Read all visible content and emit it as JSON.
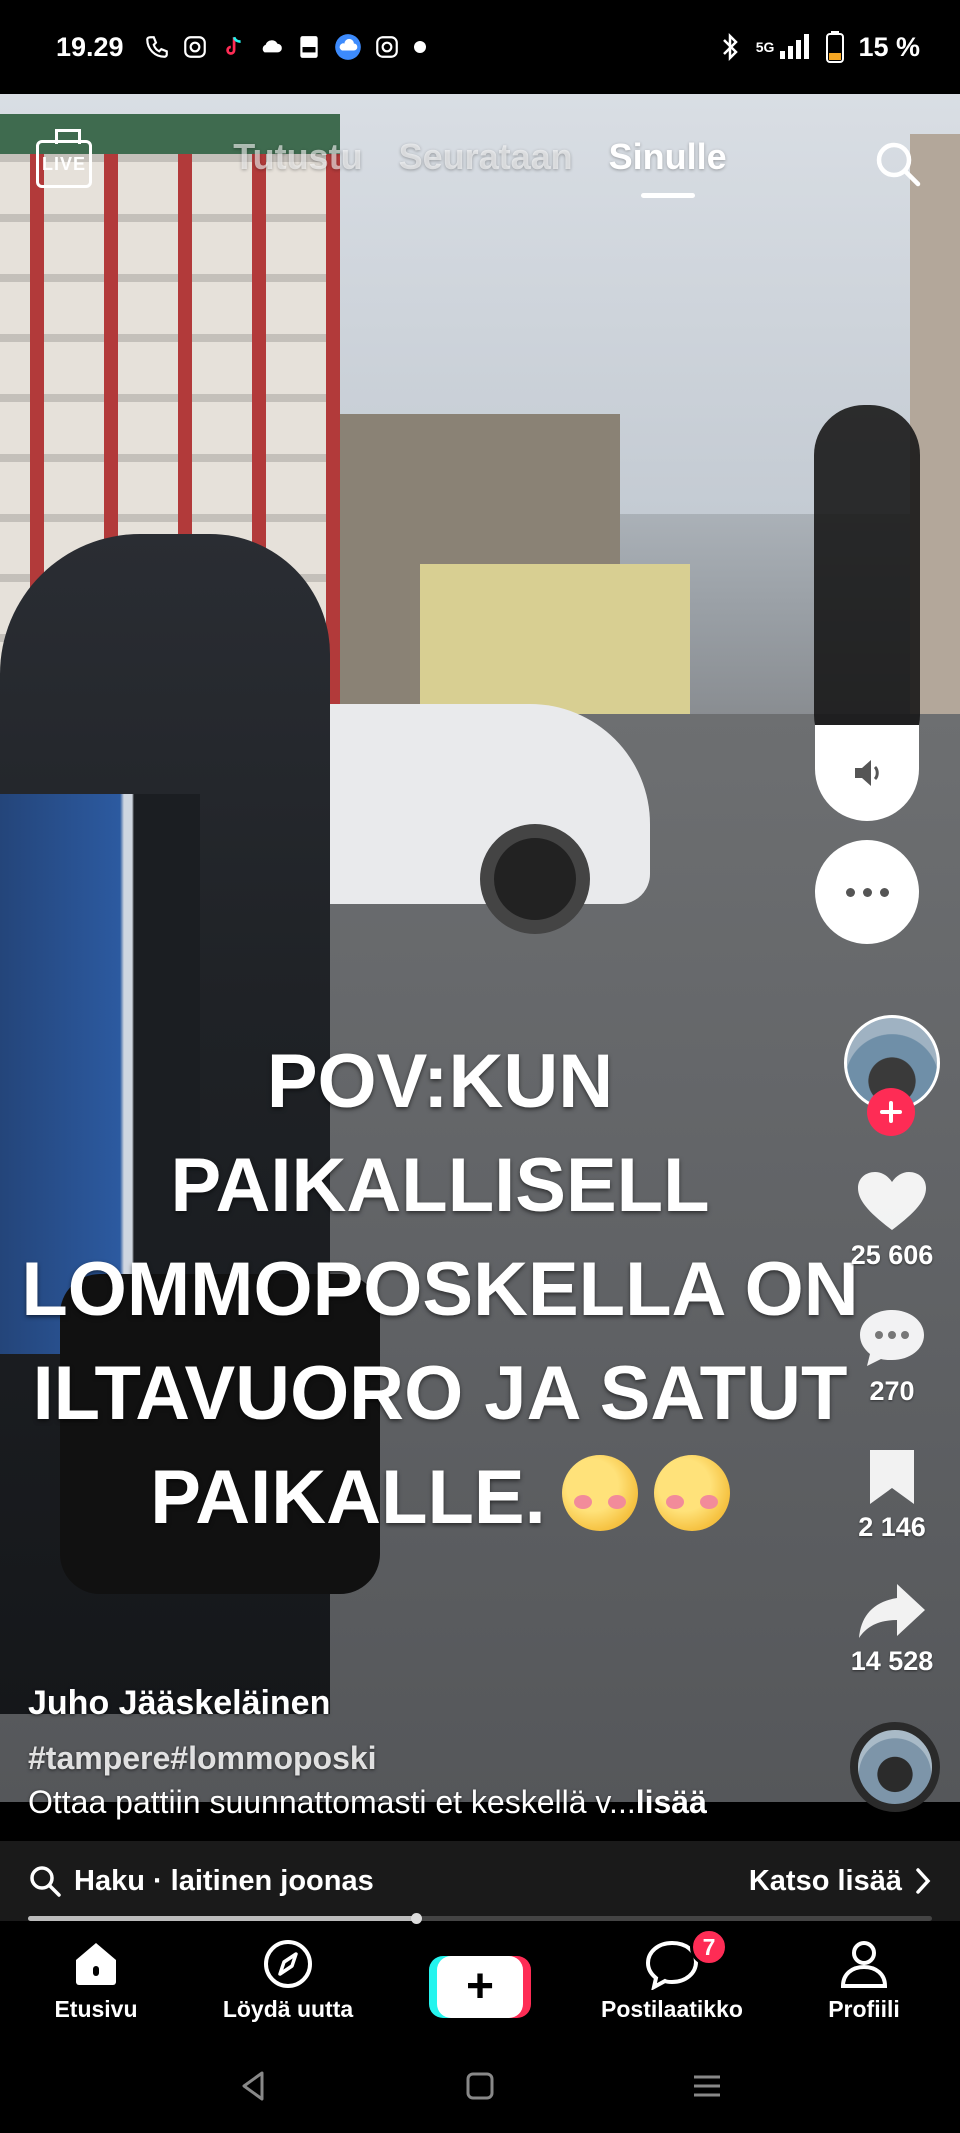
{
  "status_bar": {
    "time": "19.29",
    "network": "5G",
    "battery": "15 %"
  },
  "top_tabs": {
    "live_label": "LIVE",
    "tabs": [
      "Tutustu",
      "Seurataan",
      "Sinulle"
    ],
    "active_tab": "Sinulle"
  },
  "video": {
    "caption_line1": "POV:KUN PAIKALLISELL",
    "caption_line2": "LOMMOPOSKELLA ON",
    "caption_line3": "ILTAVUORO JA SATUT",
    "caption_line4": "PAIKALLE.",
    "caption_emoji": "woozy-face"
  },
  "actions": {
    "likes": "25 606",
    "comments": "270",
    "saves": "2 146",
    "shares": "14 528"
  },
  "post": {
    "author": "Juho Jääskeläinen",
    "hashtags": "#tampere#lommoposki",
    "description": "Ottaa pattiin suunnattomasti et keskellä v...",
    "more_label": "lisää"
  },
  "search_suggestion": {
    "query": "Haku · laitinen joonas",
    "see_more": "Katso lisää",
    "playback_progress": 0.43
  },
  "bottom_nav": {
    "home": "Etusivu",
    "discover": "Löydä uutta",
    "inbox": "Postilaatikko",
    "inbox_badge": "7",
    "profile": "Profiili"
  },
  "colors": {
    "accent_red": "#fe2c55",
    "accent_cyan": "#25f4ee"
  }
}
